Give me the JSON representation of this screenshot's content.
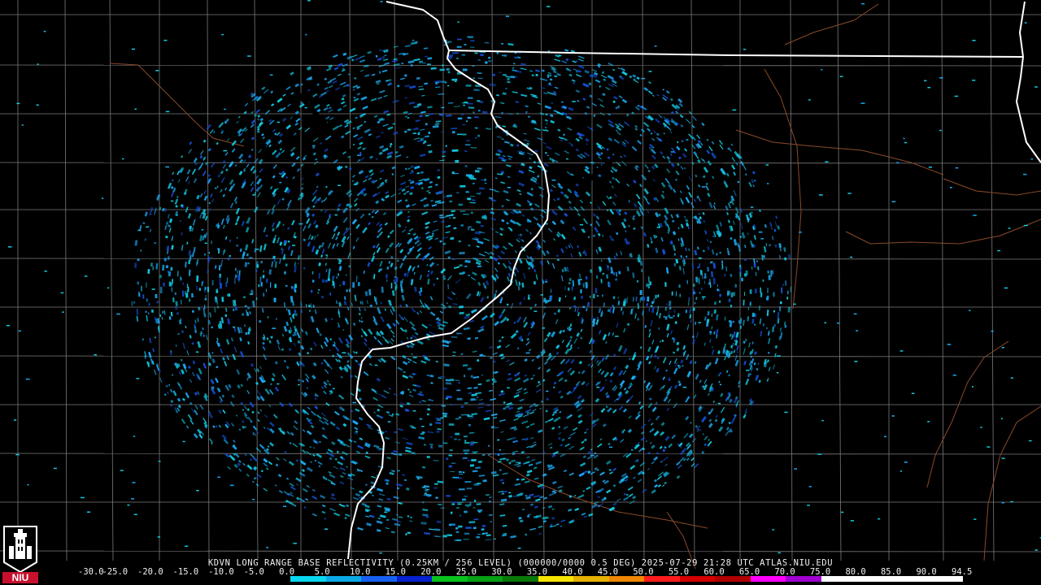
{
  "product": {
    "caption": "KDVN LONG RANGE BASE REFLECTIVITY (0.25KM / 256 LEVEL) (000000/0000 0.5 DEG) 2025-07-29 21:28 UTC  ATLAS.NIU.EDU",
    "radar_site": "KDVN",
    "timestamp": "2025-07-29 21:28 UTC",
    "source": "ATLAS.NIU.EDU"
  },
  "logo": {
    "text": "NIU",
    "icon": "university-tower-logo",
    "color": "#c8102e"
  },
  "legend": {
    "ticks": [
      "-30.0",
      "-25.0",
      "-20.0",
      "-15.0",
      "-10.0",
      "-5.0",
      "0.0",
      "5.0",
      "10.0",
      "15.0",
      "20.0",
      "25.0",
      "30.0",
      "35.0",
      "40.0",
      "45.0",
      "50.0",
      "55.0",
      "60.0",
      "65.0",
      "70.0",
      "75.0",
      "80.0",
      "85.0",
      "90.0",
      "94.5"
    ],
    "colors": [
      "#000000",
      "#000000",
      "#000000",
      "#000000",
      "#000000",
      "#000000",
      "#06d7ee",
      "#0aa9e6",
      "#1761f2",
      "#0621d0",
      "#08c21c",
      "#05a014",
      "#087808",
      "#f7e500",
      "#e6b200",
      "#ee8600",
      "#ff1c1c",
      "#d40000",
      "#b00000",
      "#ff00ff",
      "#a000d0",
      "#ffffff",
      "#ffffff",
      "#ffffff",
      "#ffffff"
    ]
  },
  "map_colors": {
    "state_border": "#ffffff",
    "county_lines": "#7a7a7a",
    "roads": "#8a4a2a",
    "echo_light": "#12c8e0",
    "echo_mid": "#1aa8f0",
    "echo_dark": "#1450d8"
  }
}
